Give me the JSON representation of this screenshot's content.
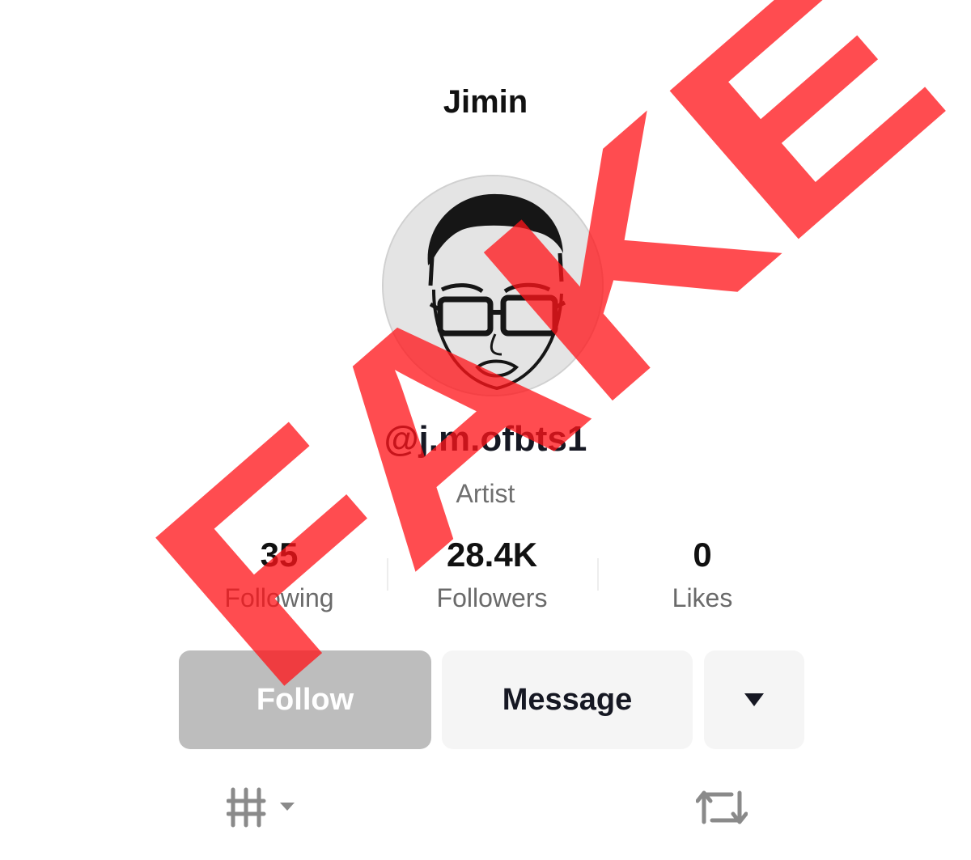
{
  "profile": {
    "display_name": "Jimin",
    "username": "@j.m.ofbts1",
    "role": "Artist"
  },
  "stats": [
    {
      "value": "35",
      "label": "Following"
    },
    {
      "value": "28.4K",
      "label": "Followers"
    },
    {
      "value": "0",
      "label": "Likes"
    }
  ],
  "actions": {
    "follow_label": "Follow",
    "message_label": "Message",
    "more_icon": "caret-down-icon"
  },
  "tabs": {
    "left_icon": "grid-icon",
    "right_icon": "repost-icon"
  },
  "overlay": {
    "stamp_text": "FAKE"
  },
  "colors": {
    "follow_button_disabled": "#bdbdbd",
    "secondary_button": "#f5f5f5",
    "stamp": "#ff1419"
  }
}
